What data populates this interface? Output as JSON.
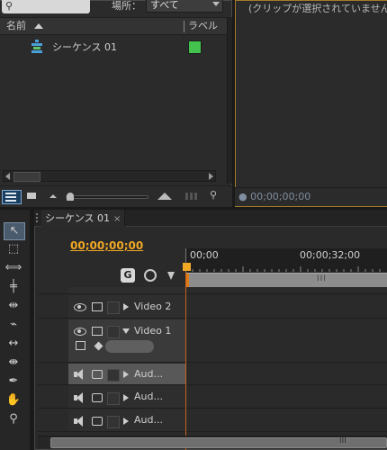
{
  "project_panel": {
    "search_icon": "magnifier",
    "location_label": "場所：",
    "location_value": "すべて",
    "columns": {
      "name": "名前",
      "label": "ラベル"
    },
    "items": [
      {
        "icon": "sequence-icon",
        "name": "シーケンス 01",
        "label_color": "#44c24e"
      }
    ]
  },
  "info_panel": {
    "message": "(クリップが選択されていません",
    "timecode": "00;00;00;00"
  },
  "tools": [
    "selection-tool",
    "track-select-tool",
    "ripple-edit-tool",
    "rolling-edit-tool",
    "rate-stretch-tool",
    "razor-tool",
    "slip-tool",
    "slide-tool",
    "pen-tool",
    "hand-tool",
    "zoom-tool"
  ],
  "timeline": {
    "tab_title": "シーケンス 01",
    "close_glyph": "×",
    "timecode": "00;00;00;00",
    "ruler_labels": [
      "00;00",
      "00;00;32;00"
    ],
    "tracks": [
      {
        "type": "video",
        "name": "Video 2",
        "expanded": false
      },
      {
        "type": "video",
        "name": "Video 1",
        "expanded": true
      },
      {
        "type": "audio",
        "name": "Aud...",
        "selected": true
      },
      {
        "type": "audio",
        "name": "Aud..."
      },
      {
        "type": "audio",
        "name": "Aud..."
      }
    ]
  }
}
